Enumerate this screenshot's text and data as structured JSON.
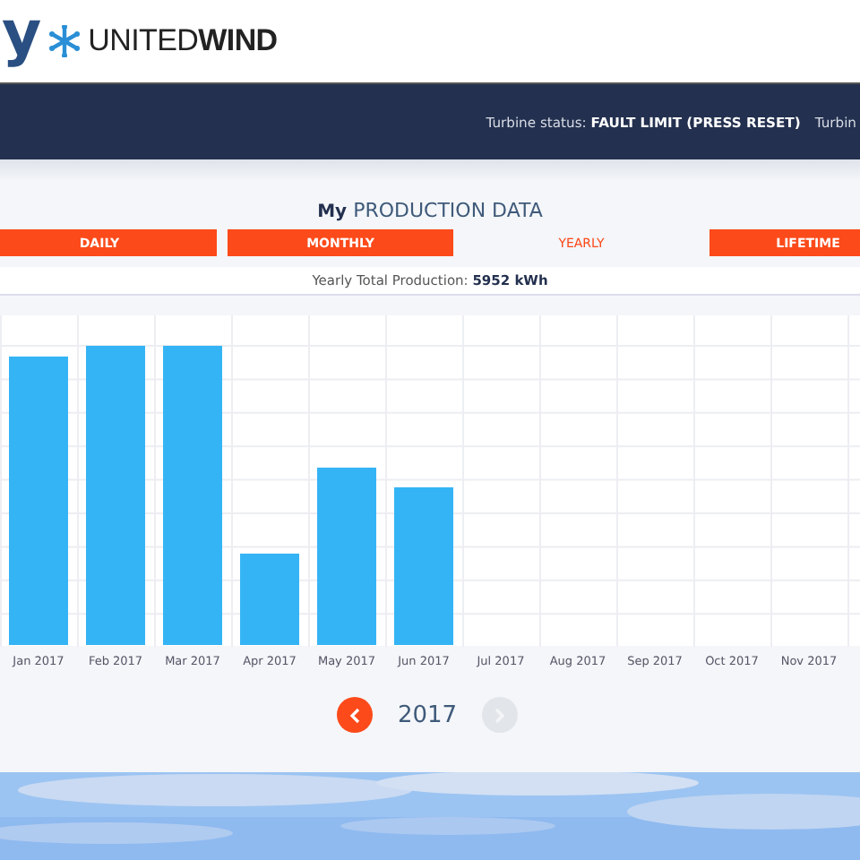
{
  "logo": {
    "partial_letter": "y",
    "brand_light": "UNITED",
    "brand_bold": "WIND"
  },
  "status_bar": {
    "label": "Turbine status:",
    "value": "FAULT LIMIT (PRESS RESET)",
    "next_label": "Turbin"
  },
  "title": "**My** PRODUCTION DATA",
  "tabs": [
    {
      "label": "DAILY",
      "selected": false
    },
    {
      "label": "MONTHLY",
      "selected": false
    },
    {
      "label": "YEARLY",
      "selected": true
    },
    {
      "label": "LIFETIME",
      "selected": false
    }
  ],
  "total": "Yearly Total Production: **5952 kWh**",
  "chart": {
    "month_labels": [
      "Jan 2017",
      "Feb 2017",
      "Mar 2017",
      "Apr 2017",
      "May 2017",
      "Jun 2017",
      "Jul 2017",
      "Aug 2017",
      "Sep 2017",
      "Oct 2017",
      "Nov 2017"
    ]
  },
  "pager": {
    "year": "2017",
    "previous_disabled": false,
    "next_disabled": true
  }
}
